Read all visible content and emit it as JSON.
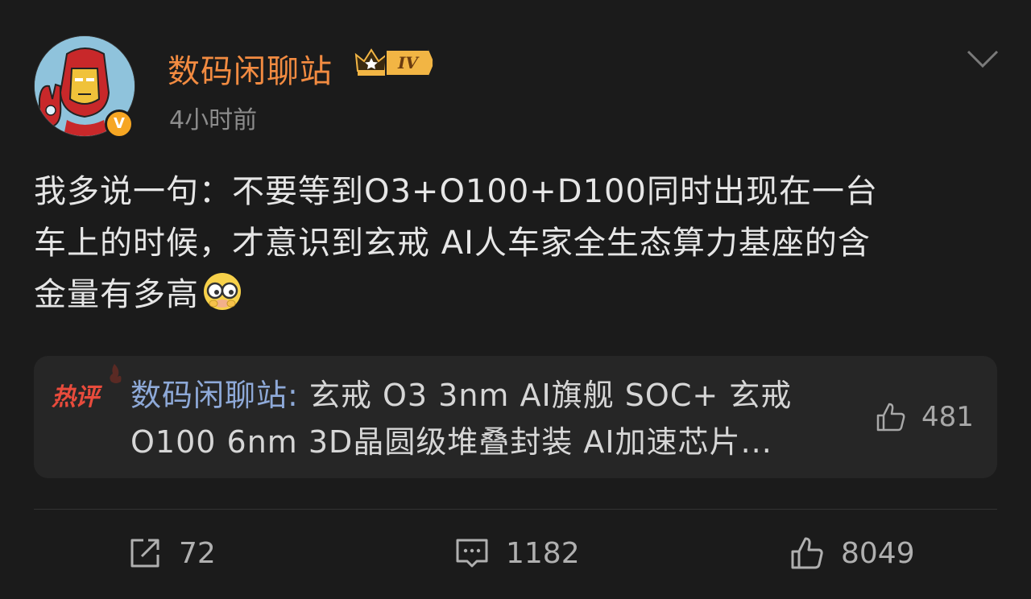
{
  "post": {
    "username": "数码闲聊站",
    "level": "IV",
    "verify_mark": "V",
    "timestamp": "4小时前",
    "text_lines": [
      "我多说一句：不要等到O3+O100+D100同时出现在一台",
      "车上的时候，才意识到玄戒 AI人车家全生态算力基座的含",
      "金量有多高"
    ],
    "emoji": "glasses-peek-emoji"
  },
  "hot_comment": {
    "tag": "热评",
    "author": "数码闲聊站",
    "separator": ":",
    "text_line1": " 玄戒 O3 3nm AI旗舰 SOC+ 玄戒",
    "text_line2": "O100 6nm 3D晶圆级堆叠封装 AI加速芯片...",
    "likes": "481"
  },
  "actions": {
    "repost_count": "72",
    "comment_count": "1182",
    "like_count": "8049"
  },
  "colors": {
    "username": "#f28b41",
    "comment_author": "#8ea9d8",
    "hot_tag": "#e84b3c",
    "background": "#1b1b1b"
  }
}
